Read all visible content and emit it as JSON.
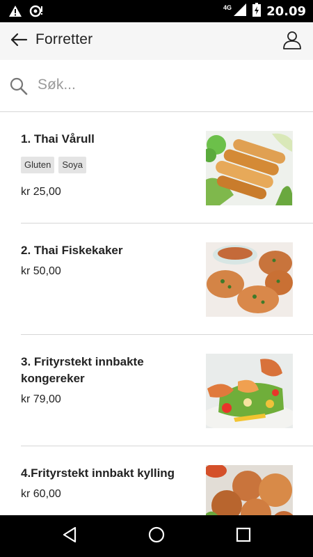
{
  "status_bar": {
    "time": "20.09",
    "network": "4G",
    "icons": [
      "warning-icon",
      "notification-icon",
      "signal-icon",
      "battery-icon"
    ]
  },
  "app_bar": {
    "title": "Forretter",
    "back_icon": "arrow-left-icon",
    "user_icon": "user-icon"
  },
  "search": {
    "placeholder": "Søk...",
    "value": ""
  },
  "products": [
    {
      "name": "1. Thai Vårull",
      "tags": [
        "Gluten",
        "Soya"
      ],
      "price": "kr 25,00",
      "image": "spring-rolls"
    },
    {
      "name": "2. Thai Fiskekaker",
      "tags": [],
      "price": "kr 50,00",
      "image": "fish-cakes"
    },
    {
      "name": "3. Frityrstekt innbakte kongereker",
      "tags": [],
      "price": "kr 79,00",
      "image": "fried-prawns"
    },
    {
      "name": "4.Frityrstekt innbakt kylling",
      "tags": [],
      "price": "kr 60,00",
      "image": "fried-chicken"
    }
  ],
  "colors": {
    "app_bar_bg": "#f6f6f6",
    "divider": "#d6d6d6",
    "tag_bg": "#e4e4e4",
    "system_bar": "#000000"
  }
}
